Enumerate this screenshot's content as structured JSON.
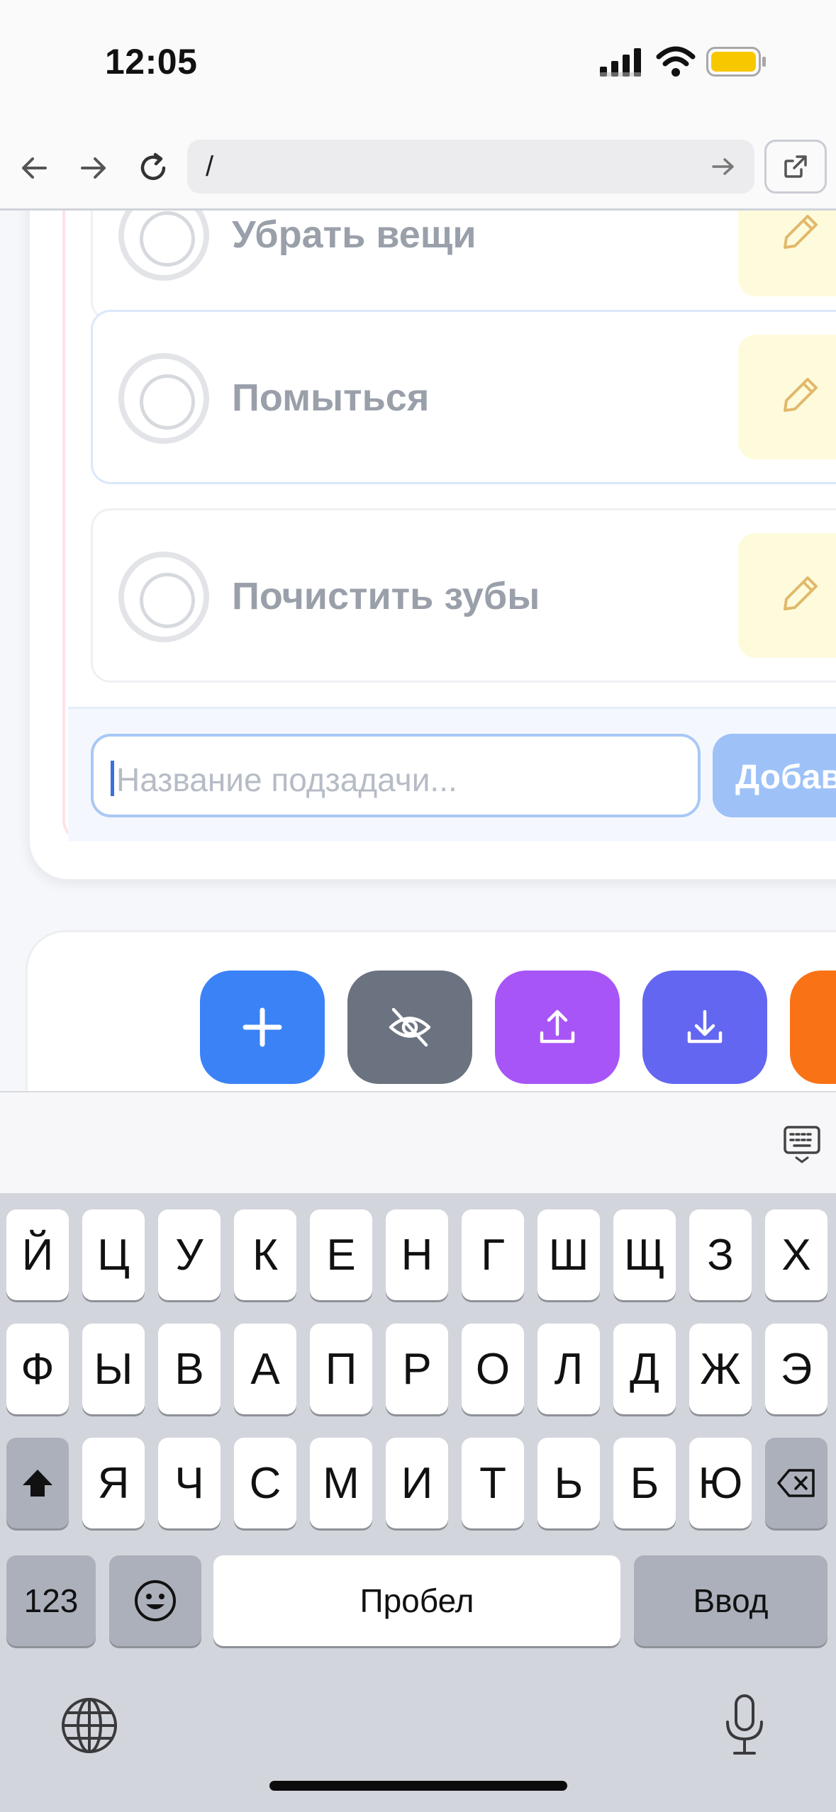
{
  "status_bar": {
    "time": "12:05"
  },
  "browser": {
    "url": "/"
  },
  "subtasks": [
    {
      "title": "Убрать вещи"
    },
    {
      "title": "Помыться"
    },
    {
      "title": "Почистить зубы"
    }
  ],
  "subtask_input": {
    "placeholder": "Название подзадачи..."
  },
  "add_button": {
    "label": "Добавить"
  },
  "toolbar": {
    "colors": {
      "add": "#3b82f6",
      "hide": "#6b7280",
      "export": "#a855f7",
      "import": "#6366f1",
      "extra": "#f97316"
    }
  },
  "keyboard": {
    "row1": [
      "Й",
      "Ц",
      "У",
      "К",
      "Е",
      "Н",
      "Г",
      "Ш",
      "Щ",
      "З",
      "Х"
    ],
    "row2": [
      "Ф",
      "Ы",
      "В",
      "А",
      "П",
      "Р",
      "О",
      "Л",
      "Д",
      "Ж",
      "Э"
    ],
    "row3": [
      "Я",
      "Ч",
      "С",
      "М",
      "И",
      "Т",
      "Ь",
      "Б",
      "Ю"
    ],
    "numbers_key": "123",
    "space_key": "Пробел",
    "return_key": "Ввод"
  }
}
